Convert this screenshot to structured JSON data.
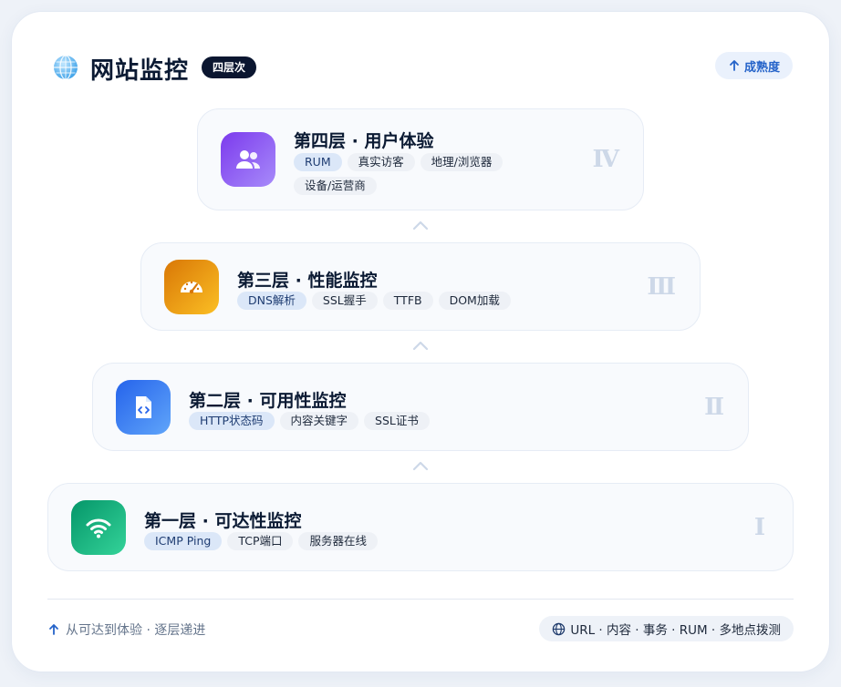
{
  "header": {
    "title": "网站监控",
    "badge": "四层次",
    "maturity_button": "成熟度"
  },
  "layers": [
    {
      "title": "第四层 · 用户体验",
      "icon": "users-icon",
      "numeral": "Ⅳ",
      "tags": [
        "RUM",
        "真实访客",
        "地理/浏览器",
        "设备/运营商"
      ],
      "color": "#8b5cf6"
    },
    {
      "title": "第三层 · 性能监控",
      "icon": "speedometer-icon",
      "numeral": "Ⅲ",
      "tags": [
        "DNS解析",
        "SSL握手",
        "TTFB",
        "DOM加载"
      ],
      "color": "#f59e0b"
    },
    {
      "title": "第二层 · 可用性监控",
      "icon": "code-file-icon",
      "numeral": "Ⅱ",
      "tags": [
        "HTTP状态码",
        "内容关键字",
        "SSL证书"
      ],
      "color": "#3b82f6"
    },
    {
      "title": "第一层 · 可达性监控",
      "icon": "wifi-icon",
      "numeral": "Ⅰ",
      "tags": [
        "ICMP Ping",
        "TCP端口",
        "服务器在线"
      ],
      "color": "#10b981"
    }
  ],
  "footer": {
    "left": "从可达到体验 · 逐层递进",
    "right": "URL · 内容 · 事务 · RUM · 多地点拨测"
  }
}
